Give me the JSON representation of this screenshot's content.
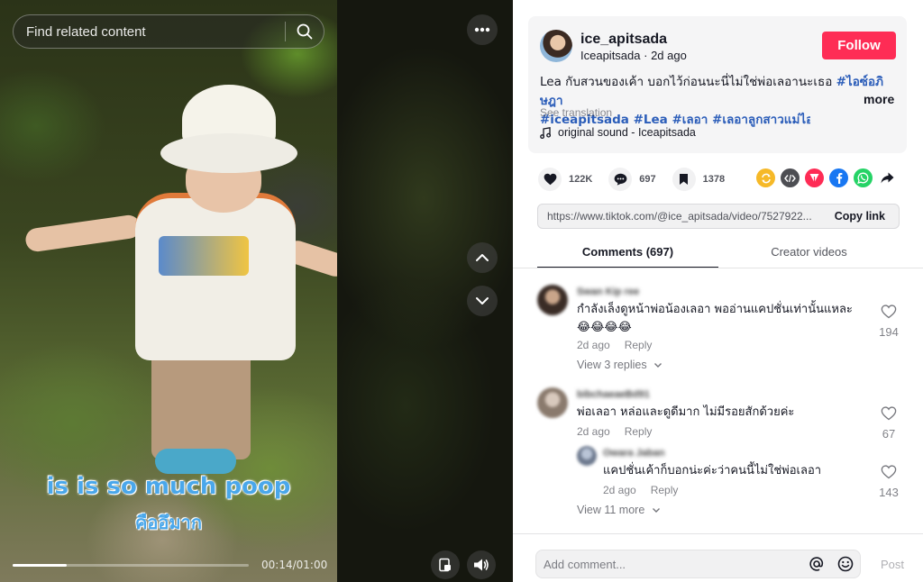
{
  "search": {
    "placeholder": "Find related content"
  },
  "video": {
    "caption_en": "is is so much poop",
    "caption_th": "คืออึมาก",
    "time": "00:14/01:00",
    "progress": 0.23
  },
  "author": {
    "username": "ice_apitsada",
    "nickname": "Iceapitsada",
    "posted": "2d ago",
    "follow_label": "Follow"
  },
  "description": {
    "text": "Lea กับสวนของเค้า บอกไว้ก่อนนะนี่ไม่ใช่พ่อเลอานะเธอ ",
    "tags_line1": "#ไอซ์อภิษฎา",
    "tags_line2": "#iceapitsada #Lea #เลอา #เลอาลูกสาวแม่ไอซ์...",
    "more_label": "more",
    "see_translation": "See translation",
    "sound": "original sound - Iceapitsada"
  },
  "stats": {
    "likes": "122K",
    "comments": "697",
    "saves": "1378"
  },
  "share": {
    "icons": [
      "repost-icon",
      "embed-icon",
      "send-icon",
      "facebook-icon",
      "whatsapp-icon",
      "share-arrow-icon"
    ],
    "colors": {
      "repost": "#f6b928",
      "embed": "#4d4e53",
      "send": "#fe2c55",
      "facebook": "#1877f2",
      "whatsapp": "#25d366"
    },
    "link": "https://www.tiktok.com/@ice_apitsada/video/7527922...",
    "copy_label": "Copy link"
  },
  "tabs": [
    {
      "label": "Comments (697)"
    },
    {
      "label": "Creator videos"
    }
  ],
  "comments": [
    {
      "name": "Swan Kip ree",
      "text": "กำลังเล็งดูหน้าพ่อน้องเลอา พออ่านแคปชั่นเท่านั้นแหละ😂😂😂😂",
      "time": "2d ago",
      "reply_label": "Reply",
      "likes": "194",
      "view_replies": "View 3 replies"
    },
    {
      "name": "bibchaeaeBd91",
      "text": "พ่อเลอา หล่อและดูดีมาก ไม่มีรอยสักด้วยค่ะ",
      "time": "2d ago",
      "reply_label": "Reply",
      "likes": "67"
    },
    {
      "name": "Owara Jaban",
      "text": "แคปชั่นเค้าก็บอกน่ะค่ะว่าคนนี้ไม่ใช่พ่อเลอา",
      "time": "2d ago",
      "reply_label": "Reply",
      "likes": "143",
      "view_replies": "View 11 more"
    }
  ],
  "comment_box": {
    "placeholder": "Add comment...",
    "post_label": "Post"
  }
}
